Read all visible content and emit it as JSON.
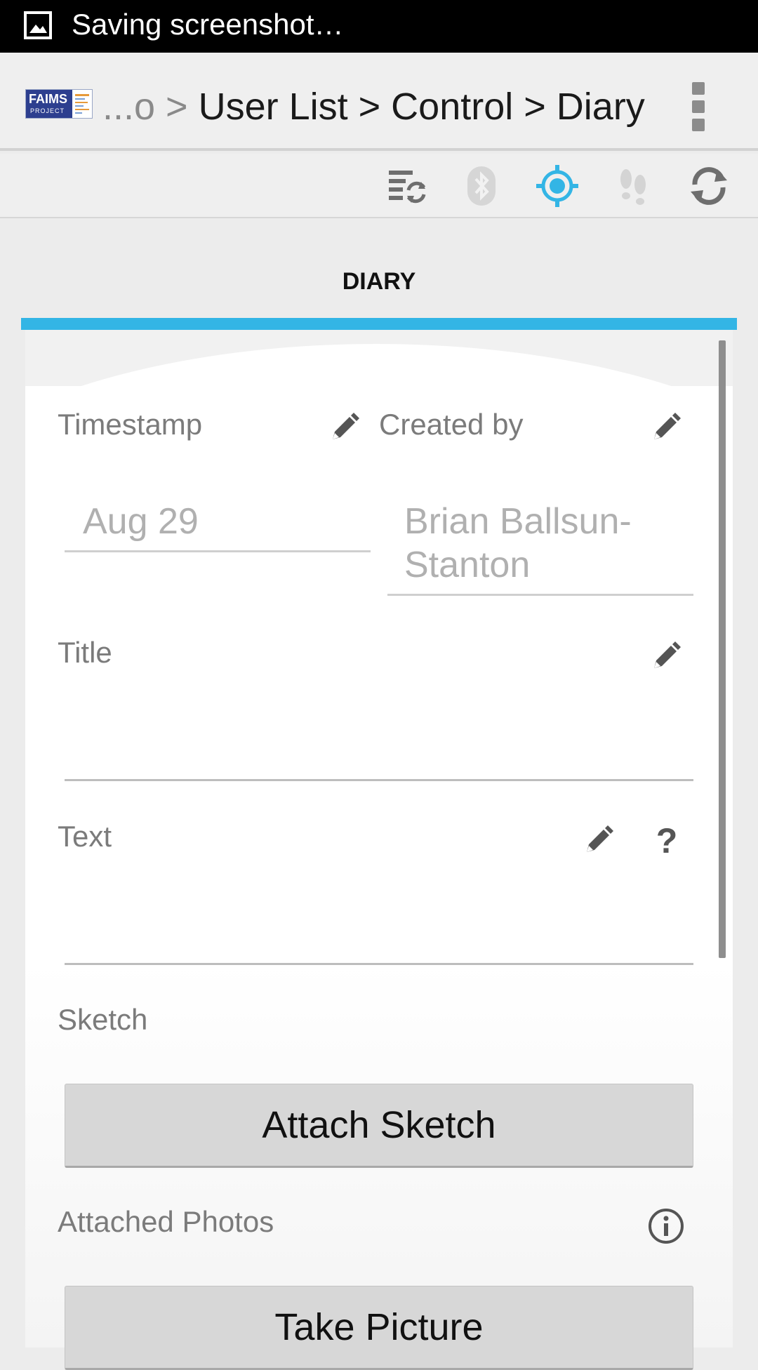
{
  "status_bar": {
    "text": "Saving screenshot…",
    "icon": "image-icon"
  },
  "action_bar": {
    "logo_text": "FAIMS",
    "logo_subtext": "PROJECT",
    "breadcrumb_faded": "...o > ",
    "breadcrumb_main": "User List > Control > Diary",
    "overflow_icon": "overflow-menu-icon"
  },
  "toolbar": {
    "icons": [
      "sync-list-icon",
      "bluetooth-icon",
      "gps-icon",
      "tracking-icon",
      "refresh-icon"
    ],
    "colors": {
      "active": "#33b5e5",
      "disabled": "#c8c8c8",
      "normal": "#6e6e6e"
    }
  },
  "tabs": [
    {
      "label": "DIARY",
      "selected": true
    }
  ],
  "accent_color": "#33b5e5",
  "form": {
    "timestamp": {
      "label": "Timestamp",
      "value": "Aug 29"
    },
    "created_by": {
      "label": "Created by",
      "value_line1": "Brian Ballsun-",
      "value_line2": "Stanton"
    },
    "title": {
      "label": "Title",
      "value": ""
    },
    "text": {
      "label": "Text",
      "value": "",
      "help_label": "?"
    },
    "sketch": {
      "label": "Sketch",
      "button_label": "Attach Sketch"
    },
    "attached_photos": {
      "label": "Attached Photos",
      "button_label": "Take Picture"
    }
  }
}
